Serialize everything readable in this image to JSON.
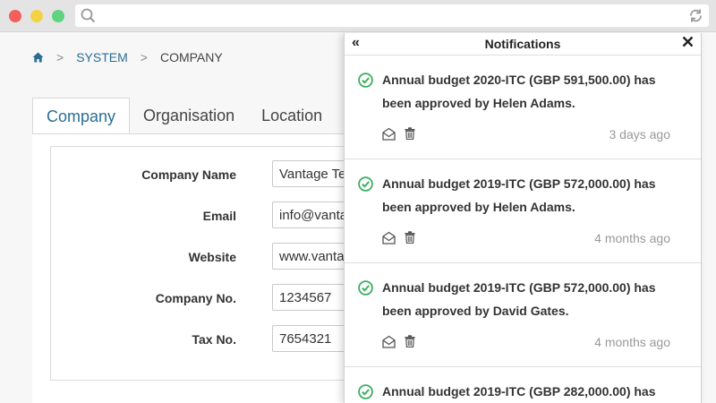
{
  "browser": {
    "address": ""
  },
  "breadcrumb": {
    "items": [
      "SYSTEM",
      "COMPANY"
    ]
  },
  "tabs": [
    {
      "label": "Company",
      "active": true
    },
    {
      "label": "Organisation",
      "active": false
    },
    {
      "label": "Location",
      "active": false
    }
  ],
  "form": {
    "company_name_label": "Company Name",
    "company_name_value": "Vantage Te",
    "email_label": "Email",
    "email_value": "info@vanta",
    "website_label": "Website",
    "website_value": "www.vanta",
    "company_no_label": "Company No.",
    "company_no_value": "1234567",
    "tax_no_label": "Tax No.",
    "tax_no_value": "7654321"
  },
  "notifications": {
    "title": "Notifications",
    "collapse_icon": "«",
    "items": [
      {
        "message": "Annual budget 2020-ITC (GBP 591,500.00) has been approved by Helen Adams.",
        "time": "3 days ago"
      },
      {
        "message": "Annual budget 2019-ITC (GBP 572,000.00) has been approved by Helen Adams.",
        "time": "4 months ago"
      },
      {
        "message": "Annual budget 2019-ITC (GBP 572,000.00) has been approved by David Gates.",
        "time": "4 months ago"
      },
      {
        "message": "Annual budget 2019-ITC (GBP 282,000.00) has",
        "time": ""
      }
    ]
  },
  "colors": {
    "accent": "#2a6e94",
    "success": "#3aae5f",
    "muted": "#999999"
  }
}
